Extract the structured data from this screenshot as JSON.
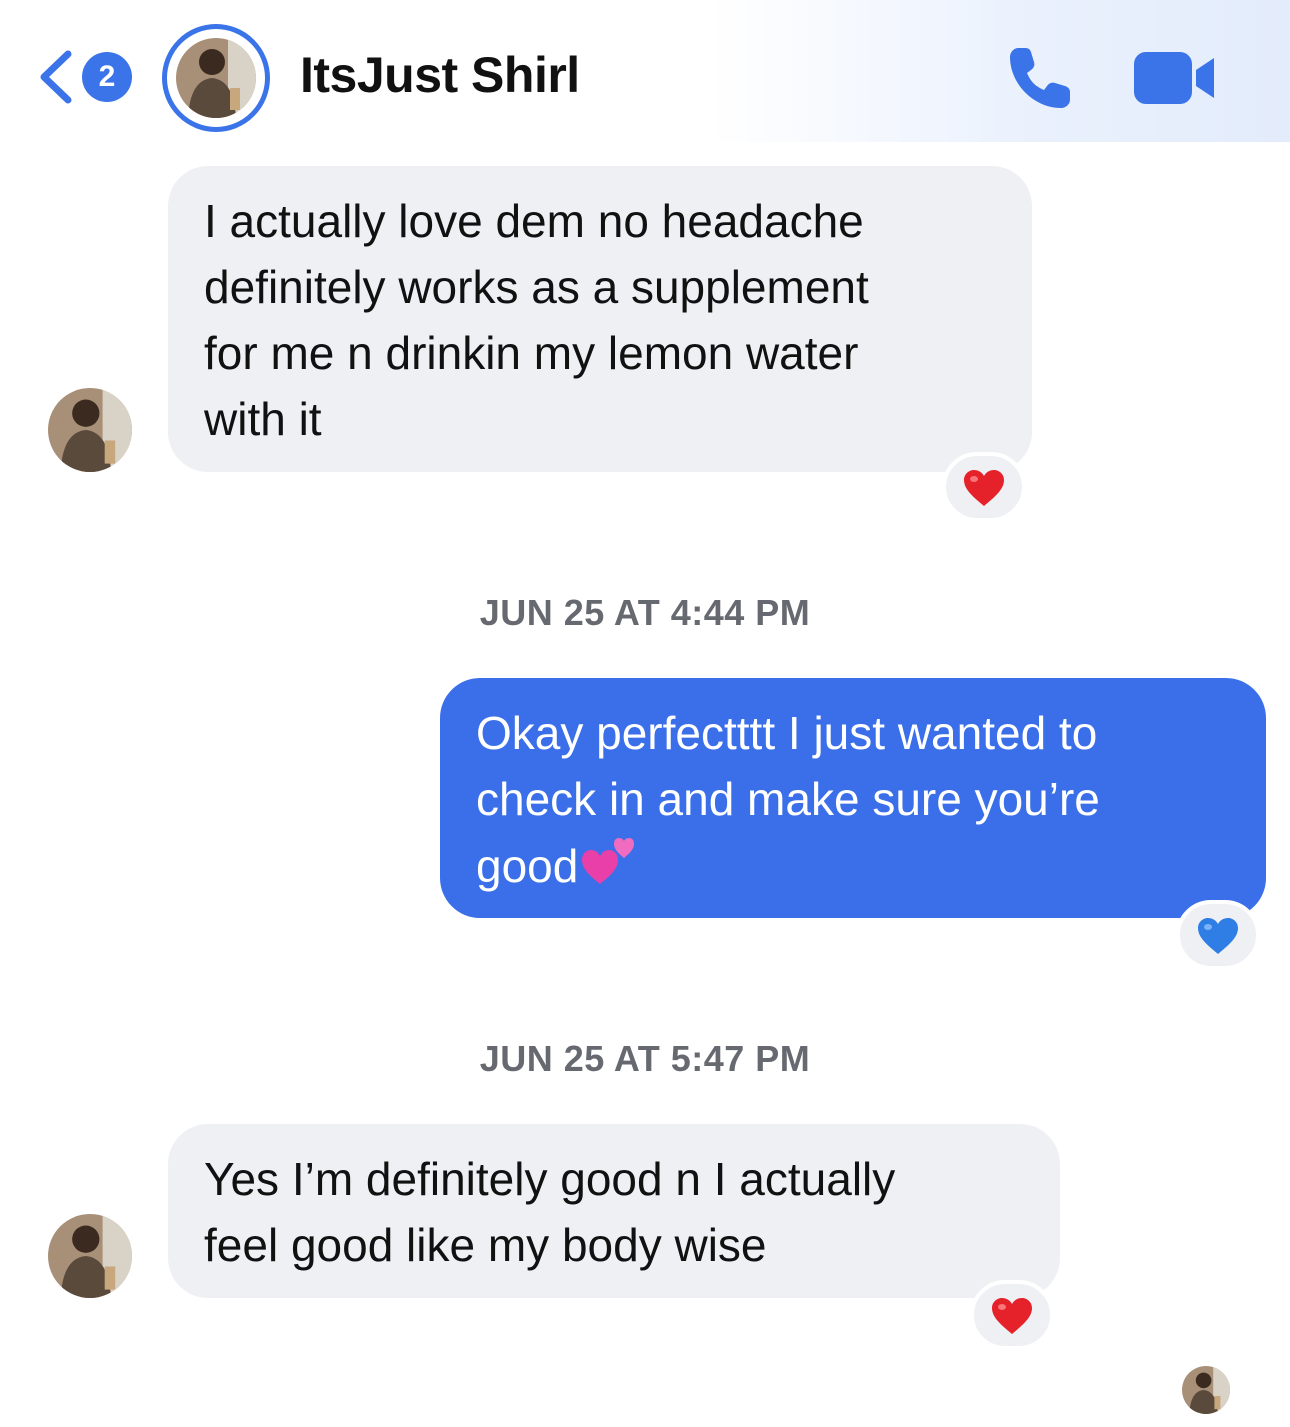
{
  "header": {
    "back_badge_count": "2",
    "contact_name": "ItsJust Shirl"
  },
  "messages": [
    {
      "direction": "incoming",
      "lines": [
        "I actually love dem no headache",
        "definitely works as a supplement",
        "for me n drinkin my lemon water",
        "with it"
      ],
      "reaction": "red-heart"
    },
    {
      "type": "timestamp",
      "text": "JUN 25 AT 4:44 PM"
    },
    {
      "direction": "outgoing",
      "lines": [
        "Okay perfectttt I just wanted to",
        "check in and make sure you’re",
        "good"
      ],
      "trailing_emoji": "two-hearts",
      "reaction": "blue-heart"
    },
    {
      "type": "timestamp",
      "text": "JUN 25 AT 5:47 PM"
    },
    {
      "direction": "incoming",
      "lines": [
        "Yes I’m definitely good n I actually",
        "feel good like my body wise"
      ],
      "reaction": "red-heart"
    }
  ],
  "colors": {
    "accent": "#3b74e8",
    "outgoing_bubble": "#3a6fe9",
    "incoming_bubble": "#eff0f4",
    "timestamp_text": "#666a70"
  }
}
